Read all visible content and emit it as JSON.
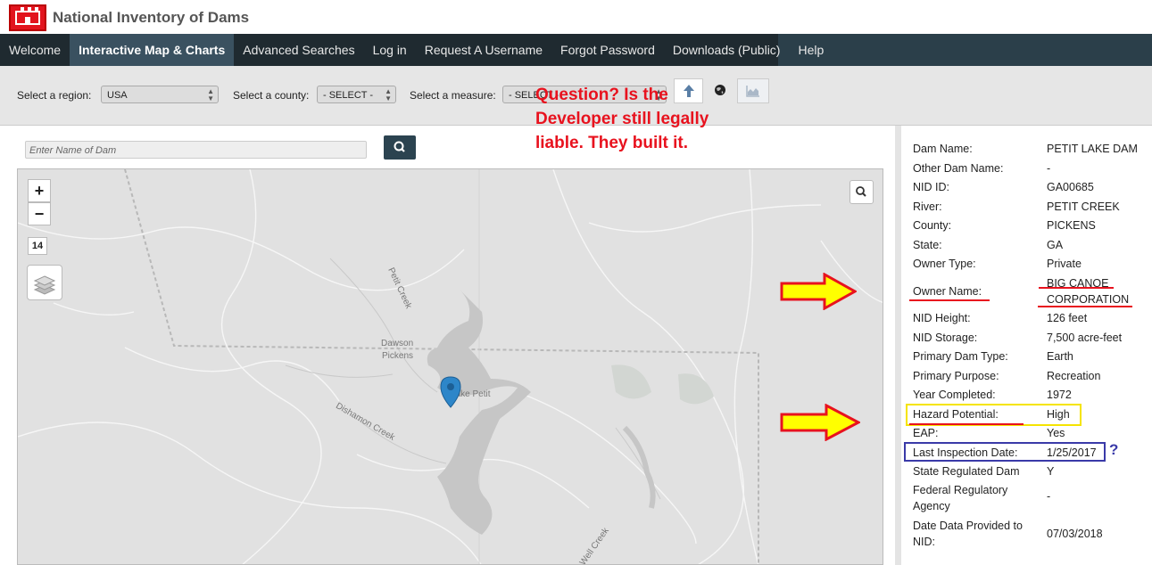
{
  "header": {
    "title": "National Inventory of Dams"
  },
  "nav": {
    "items": [
      "Welcome",
      "Interactive Map & Charts",
      "Advanced Searches",
      "Log in",
      "Request A Username",
      "Forgot Password",
      "Downloads (Public)",
      "Help"
    ],
    "active_index": 1
  },
  "filters": {
    "region_label": "Select a region:",
    "region_value": "USA",
    "county_label": "Select a county:",
    "county_value": "- SELECT -",
    "measure_label": "Select a measure:",
    "measure_value": "- SELECT -",
    "icons": [
      "up-arrow-icon",
      "globe-icon",
      "area-chart-icon"
    ]
  },
  "search": {
    "placeholder": "Enter Name of Dam"
  },
  "map": {
    "zoom_in": "+",
    "zoom_out": "−",
    "zoom_level": "14",
    "labels": {
      "petit_creek": "Petit Creek",
      "dawson": "Dawson",
      "pickens": "Pickens",
      "lake_petit": "Lake Petit",
      "dishamon_creek": "Dishamon Creek",
      "well_creek": "Well Creek"
    }
  },
  "annotation": {
    "lines": [
      "Question?  Is the",
      "Developer still legally",
      "liable.  They built it."
    ],
    "color": "#e8121e",
    "question_mark": "?"
  },
  "dam_info": {
    "fields": [
      {
        "label": "Dam Name:",
        "value": "PETIT LAKE DAM"
      },
      {
        "label": "Other Dam Name:",
        "value": "-"
      },
      {
        "label": "NID ID:",
        "value": "GA00685"
      },
      {
        "label": "River:",
        "value": "PETIT CREEK"
      },
      {
        "label": "County:",
        "value": "PICKENS"
      },
      {
        "label": "State:",
        "value": "GA"
      },
      {
        "label": "Owner Type:",
        "value": "Private"
      },
      {
        "label": "Owner Name:",
        "value": "BIG CANOE",
        "value2": "CORPORATION"
      },
      {
        "label": "NID Height:",
        "value": "126 feet"
      },
      {
        "label": "NID Storage:",
        "value": "7,500 acre-feet"
      },
      {
        "label": "Primary Dam Type:",
        "value": "Earth"
      },
      {
        "label": "Primary Purpose:",
        "value": "Recreation"
      },
      {
        "label": "Year Completed:",
        "value": "1972"
      },
      {
        "label": "Hazard Potential:",
        "value": "High"
      },
      {
        "label": "EAP:",
        "value": "Yes"
      },
      {
        "label": "Last Inspection Date:",
        "value": "1/25/2017"
      },
      {
        "label": "State Regulated Dam",
        "value": "Y"
      },
      {
        "label": "Federal Regulatory",
        "label2": "Agency",
        "value": "-"
      },
      {
        "label": "Date Data Provided to",
        "label2": "NID:",
        "value": "07/03/2018"
      }
    ]
  }
}
